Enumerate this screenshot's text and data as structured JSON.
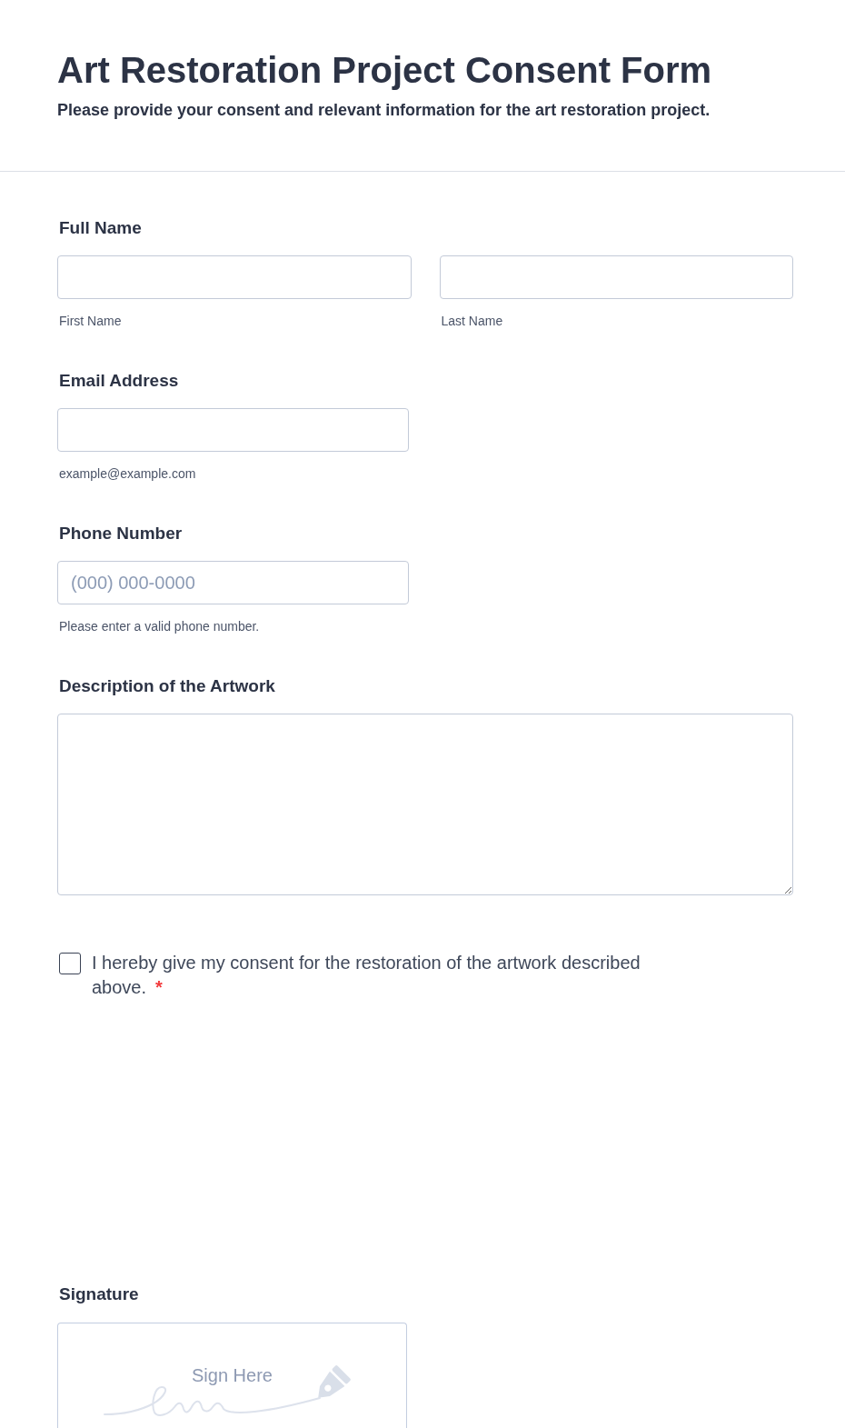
{
  "header": {
    "title": "Art Restoration Project Consent Form",
    "subtitle": "Please provide your consent and relevant information for the art restoration project."
  },
  "fields": [
    {
      "kind": "name_pair",
      "label": "Full Name",
      "parts": [
        {
          "sublabel": "First Name"
        },
        {
          "sublabel": "Last Name"
        }
      ]
    },
    {
      "kind": "email",
      "label": "Email Address",
      "sublabel": "example@example.com"
    },
    {
      "kind": "phone",
      "label": "Phone Number",
      "placeholder": "(000) 000-0000",
      "sublabel": "Please enter a valid phone number."
    },
    {
      "kind": "textarea",
      "label": "Description of the Artwork"
    },
    {
      "kind": "checkbox",
      "label": "I hereby give my consent for the restoration of the artwork described above.",
      "required_mark": "*",
      "checked": false
    },
    {
      "kind": "signature",
      "label": "Signature",
      "placeholder": "Sign Here"
    }
  ]
}
